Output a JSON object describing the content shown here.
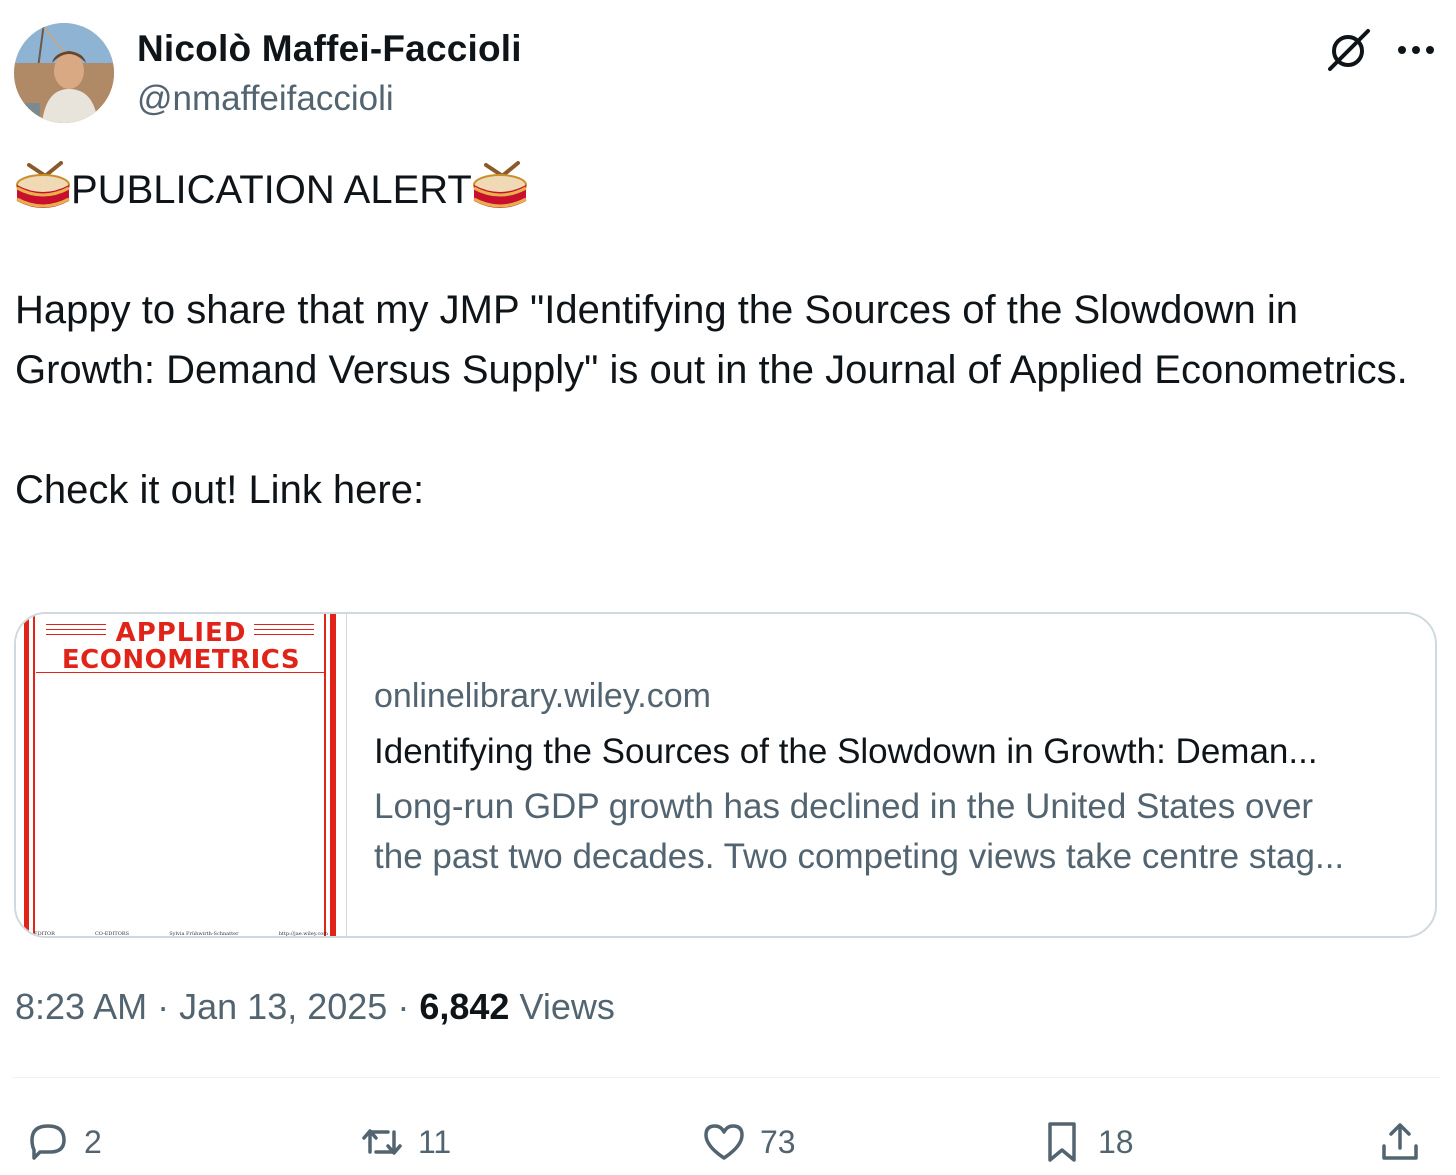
{
  "author": {
    "name": "Nicolò Maffei-Faccioli",
    "handle": "@nmaffeifaccioli"
  },
  "icons": {
    "grok": "grok-icon",
    "more": "more-icon",
    "drum": "drum-emoji-icon"
  },
  "post": {
    "alert_text": "PUBLICATION ALERT",
    "body": "Happy to share that my JMP \"Identifying the Sources of the Slowdown in Growth: Demand Versus Supply\" is out in the Journal of Applied Econometrics.\n\nCheck it out! Link here:"
  },
  "card": {
    "cover_line1": "APPLIED",
    "cover_line2": "ECONOMETRICS",
    "cover_foot": [
      "EDITOR",
      "CO-EDITORS",
      "Sylvia Frühwirth-Schnatter",
      "http://jae.wiley.com"
    ],
    "domain": "onlinelibrary.wiley.com",
    "title": "Identifying the Sources of the Slowdown in Growth: Deman...",
    "desc_line1": "Long-run GDP growth has declined in the United States over",
    "desc_line2": "the past two decades. Two competing views take centre stag..."
  },
  "meta": {
    "time": "8:23 AM",
    "sep": "·",
    "date": "Jan 13, 2025",
    "views_count": "6,842",
    "views_label": "Views"
  },
  "actions": {
    "replies": "2",
    "reposts": "11",
    "likes": "73",
    "bookmarks": "18"
  },
  "colors": {
    "text": "#0f1419",
    "secondary": "#536471",
    "border": "#cfd9de",
    "cover_red": "#e0241a"
  }
}
